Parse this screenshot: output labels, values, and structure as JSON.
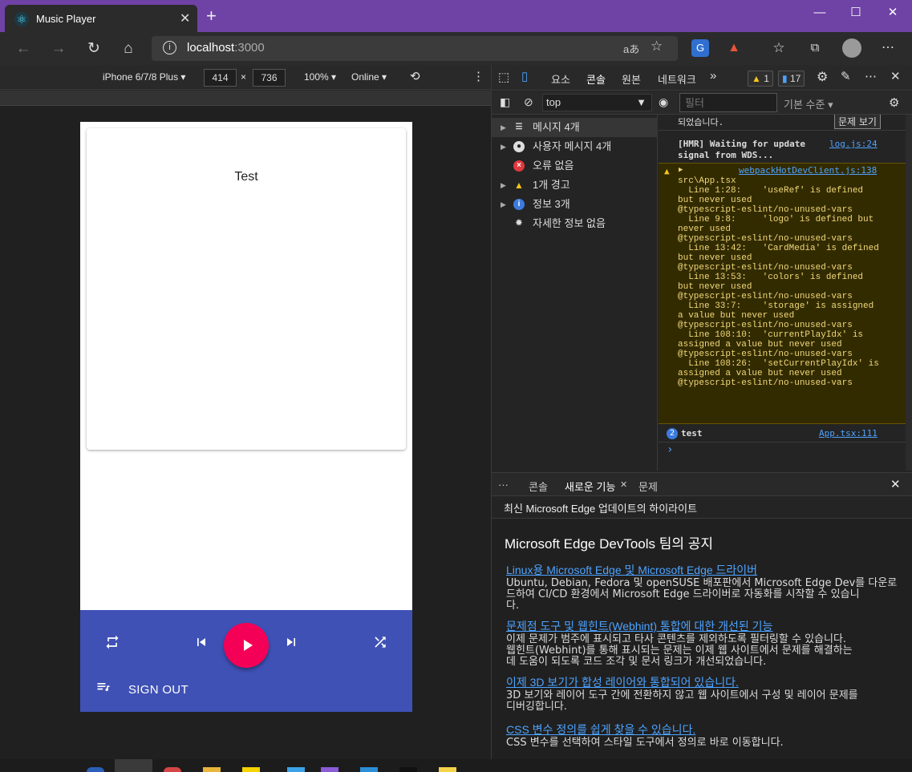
{
  "browser": {
    "tab_title": "Music Player",
    "tab_close": "✕",
    "new_tab": "+",
    "window_controls": {
      "minimize": "—",
      "maximize": "☐",
      "close": "✕"
    },
    "address_host": "localhost",
    "address_port": ":3000"
  },
  "device_toolbar": {
    "device": "iPhone 6/7/8 Plus",
    "width": "414",
    "times": "×",
    "height": "736",
    "zoom": "100%",
    "network": "Online"
  },
  "app": {
    "card_title": "Test",
    "signout_label": "SIGN OUT",
    "colors": {
      "player_bar": "#3f51b5",
      "play_button": "#f50057"
    }
  },
  "devtools": {
    "tabs": [
      "요소",
      "콘솔",
      "원본",
      "네트워크"
    ],
    "more_tabs": "»",
    "warn_count": "1",
    "issue_count": "17",
    "context": "top",
    "filter_placeholder": "필터",
    "level": "기본 수준",
    "sidebar": [
      {
        "label": "메시지 4개",
        "icon": "list-icon"
      },
      {
        "label": "사용자 메시지 4개",
        "icon": "user-icon"
      },
      {
        "label": "오류 없음",
        "icon": "error-icon"
      },
      {
        "label": "1개 경고",
        "icon": "warning-icon"
      },
      {
        "label": "정보 3개",
        "icon": "info-icon"
      },
      {
        "label": "자세한 정보 없음",
        "icon": "bug-icon"
      }
    ],
    "console": {
      "issue_text": "되었습니다.",
      "issue_link": "문제 보기",
      "hmr_text": "[HMR] Waiting for update\nsignal from WDS...",
      "hmr_source": "log.js:24",
      "warn_source": "webpackHotDevClient.js:138",
      "warn_text": "src\\App.tsx\n  Line 1:28:    'useRef' is defined\nbut never used\n@typescript-eslint/no-unused-vars\n  Line 9:8:     'logo' is defined but\nnever used\n@typescript-eslint/no-unused-vars\n  Line 13:42:   'CardMedia' is defined\nbut never used\n@typescript-eslint/no-unused-vars\n  Line 13:53:   'colors' is defined\nbut never used\n@typescript-eslint/no-unused-vars\n  Line 33:7:    'storage' is assigned\na value but never used\n@typescript-eslint/no-unused-vars\n  Line 108:10:  'currentPlayIdx' is\nassigned a value but never used\n@typescript-eslint/no-unused-vars\n  Line 108:26:  'setCurrentPlayIdx' is\nassigned a value but never used\n@typescript-eslint/no-unused-vars",
      "log_count": "2",
      "log_text": "test",
      "log_source": "App.tsx:111",
      "prompt": "›"
    },
    "drawer": {
      "more": "···",
      "tabs": [
        "콘솔",
        "새로운 기능",
        "문제"
      ],
      "header": "최신 Microsoft Edge 업데이트의 하이라이트",
      "title": "Microsoft Edge DevTools 팀의 공지",
      "items": [
        {
          "link": "Linux용 Microsoft Edge 및 Microsoft Edge 드라이버",
          "body": "Ubuntu, Debian, Fedora 및 openSUSE 배포판에서 Microsoft Edge Dev를 다운로\n드하여 CI/CD 환경에서 Microsoft Edge 드라이버로 자동화를 시작할 수 있습니\n다."
        },
        {
          "link": "문제점 도구 및 웹힌트(Webhint) 통합에 대한 개선된 기능",
          "body": "이제 문제가 범주에 표시되고 타사 콘텐츠를 제외하도록 필터링할 수 있습니다.\n웹힌트(Webhint)를 통해 표시되는 문제는 이제 웹 사이트에서 문제를 해결하는\n데 도움이 되도록 코드 조각 및 문서 링크가 개선되었습니다."
        },
        {
          "link": "이제 3D 보기가 합성 레이어와 통합되어 있습니다.",
          "body": "3D 보기와 레이어 도구 간에 전환하지 않고 웹 사이트에서 구성 및 레이어 문제를\n디버깅합니다."
        },
        {
          "link": "CSS 변수 정의를 쉽게 찾을 수 있습니다.",
          "body": "CSS 변수를 선택하여 스타일 도구에서 정의로 바로 이동합니다."
        }
      ]
    }
  }
}
